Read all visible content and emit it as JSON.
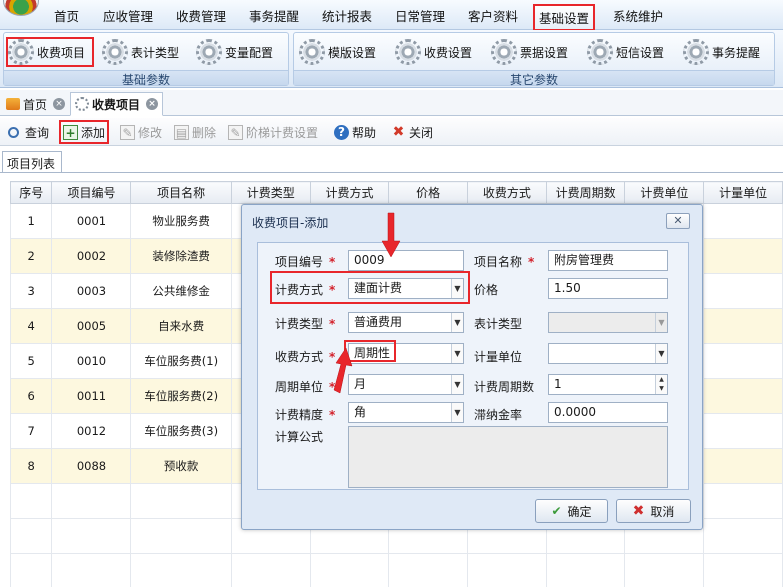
{
  "menubar": {
    "items": [
      "首页",
      "应收管理",
      "收费管理",
      "事务提醒",
      "统计报表",
      "日常管理",
      "客户资料",
      "基础设置",
      "系统维护"
    ]
  },
  "ribbon": {
    "group1": {
      "label": "基础参数",
      "buttons": [
        "收费项目",
        "表计类型",
        "变量配置"
      ]
    },
    "group2": {
      "label": "其它参数",
      "buttons": [
        "模版设置",
        "收费设置",
        "票据设置",
        "短信设置",
        "事务提醒"
      ]
    }
  },
  "tabs": [
    "首页",
    "收费项目"
  ],
  "toolbar": {
    "query": "查询",
    "add": "添加",
    "edit": "修改",
    "delete": "删除",
    "tiered": "阶梯计费设置",
    "help": "帮助",
    "close": "关闭"
  },
  "list": {
    "tab": "项目列表",
    "columns": [
      "序号",
      "项目编号",
      "项目名称",
      "计费类型",
      "计费方式",
      "价格",
      "收费方式",
      "计费周期数",
      "计费单位",
      "计量单位"
    ],
    "rows": [
      [
        "1",
        "0001",
        "物业服务费"
      ],
      [
        "2",
        "0002",
        "装修除渣费"
      ],
      [
        "3",
        "0003",
        "公共维修金"
      ],
      [
        "4",
        "0005",
        "自来水费"
      ],
      [
        "5",
        "0010",
        "车位服务费(1)"
      ],
      [
        "6",
        "0011",
        "车位服务费(2)"
      ],
      [
        "7",
        "0012",
        "车位服务费(3)"
      ],
      [
        "8",
        "0088",
        "预收款"
      ]
    ]
  },
  "dialog": {
    "title": "收费项目-添加",
    "labels": {
      "code": "项目编号",
      "name": "项目名称",
      "billing_method": "计费方式",
      "price": "价格",
      "billing_type": "计费类型",
      "meter_type": "表计类型",
      "charge_method": "收费方式",
      "measure_unit": "计量单位",
      "period_unit": "周期单位",
      "period_count": "计费周期数",
      "precision": "计费精度",
      "late_fee_rate": "滞纳金率",
      "formula": "计算公式"
    },
    "values": {
      "code": "0009",
      "name": "附房管理费",
      "billing_method": "建面计费",
      "price": "1.50",
      "billing_type": "普通费用",
      "meter_type": "",
      "charge_method": "周期性",
      "measure_unit": "",
      "period_unit": "月",
      "period_count": "1",
      "precision": "角",
      "late_fee_rate": "0.0000",
      "formula": ""
    },
    "ok": "确定",
    "cancel": "取消"
  },
  "colors": {
    "highlight": "#e8262b",
    "required": "#d3212b",
    "row_alt": "#fdf8df"
  }
}
